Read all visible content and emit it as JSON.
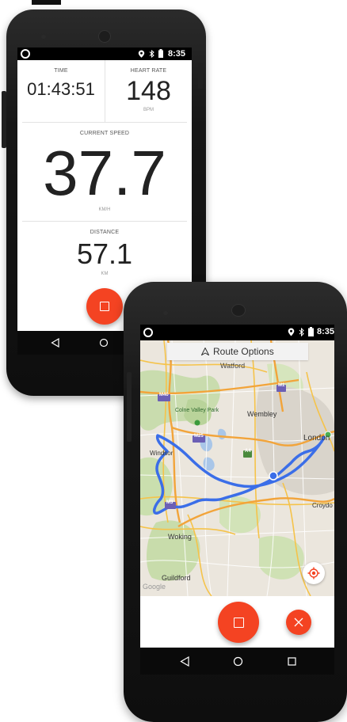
{
  "phone1": {
    "status": {
      "time": "8:35"
    },
    "time": {
      "label": "TIME",
      "value": "01:43:51"
    },
    "heart_rate": {
      "label": "HEART RATE",
      "value": "148",
      "unit": "BPM"
    },
    "current_speed": {
      "label": "CURRENT SPEED",
      "value": "37.7",
      "unit": "KM/H"
    },
    "distance": {
      "label": "DISTANCE",
      "value": "57.1",
      "unit": "KM"
    }
  },
  "phone2": {
    "status": {
      "time": "8:35"
    },
    "route_options": {
      "label": "Route Options"
    },
    "map": {
      "labels": {
        "watford": "Watford",
        "m40": "M40",
        "m1": "M1",
        "colne_valley": "Colne Valley Park",
        "wembley": "Wembley",
        "london": "London",
        "m25": "M25",
        "a4": "A4",
        "windsor": "Windsor",
        "m3": "M3",
        "croydon": "Croydo",
        "woking": "Woking",
        "guildford": "Guildford",
        "google": "Google"
      }
    }
  },
  "colors": {
    "accent": "#f44322",
    "route": "#3b6ee8",
    "nav_bar": "#0a0a0a"
  },
  "icons": [
    "location-pin-icon",
    "bluetooth-icon",
    "battery-icon",
    "back-icon",
    "home-icon",
    "recents-icon",
    "navigation-arrow-icon",
    "my-location-icon",
    "stop-icon",
    "close-icon"
  ]
}
